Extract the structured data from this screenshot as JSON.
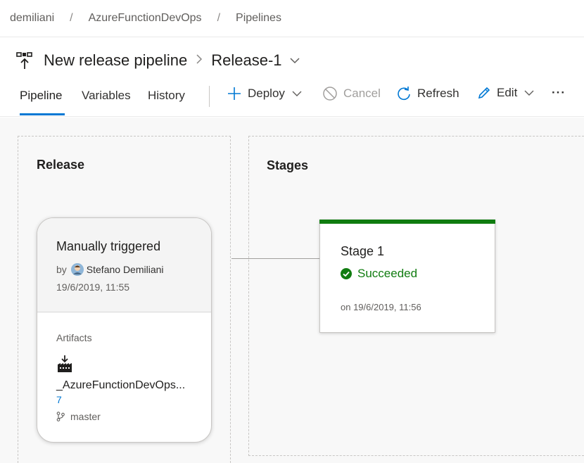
{
  "breadcrumb": [
    "demiliani",
    "AzureFunctionDevOps",
    "Pipelines"
  ],
  "header": {
    "pipeline_name": "New release pipeline",
    "release_name": "Release-1"
  },
  "tabs": [
    "Pipeline",
    "Variables",
    "History"
  ],
  "active_tab": "Pipeline",
  "commands": {
    "deploy": "Deploy",
    "cancel": "Cancel",
    "refresh": "Refresh",
    "edit": "Edit",
    "more": "···"
  },
  "release_panel": {
    "title": "Release",
    "trigger": "Manually triggered",
    "by_label": "by",
    "user": "Stefano Demiliani",
    "date": "19/6/2019, 11:55",
    "artifacts_label": "Artifacts",
    "artifact_name": "_AzureFunctionDevOps...",
    "artifact_version": "7",
    "branch": "master"
  },
  "stages_panel": {
    "title": "Stages",
    "stage": {
      "name": "Stage 1",
      "status": "Succeeded",
      "time": "on 19/6/2019, 11:56"
    }
  },
  "colors": {
    "accent": "#0078d4",
    "success": "#107c10",
    "disabled": "#a19f9d"
  },
  "icons": {
    "pipeline": "release-pipeline-icon",
    "deploy": "plus-icon",
    "cancel": "cancel-icon",
    "refresh": "refresh-icon",
    "edit": "pencil-icon",
    "artifact": "build-artifact-icon",
    "branch": "git-branch-icon",
    "status": "check-circle-icon"
  }
}
